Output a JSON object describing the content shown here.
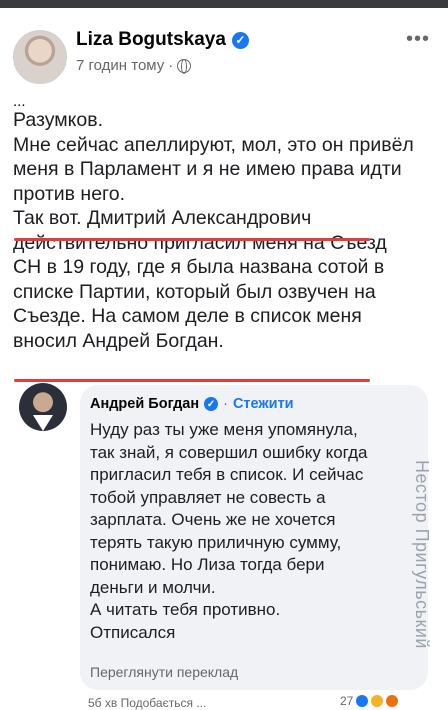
{
  "post": {
    "author": "Liza Bogutskaya",
    "verified_icon": "check",
    "time": "7 годин тому",
    "visibility_icon": "globe-icon",
    "more_label": "•••",
    "ellipsis": "...",
    "lines": [
      "Разумков.",
      "Мне сейчас апеллируют, мол, это он привёл",
      "меня в Парламент и я не имею права идти",
      "против него.",
      "Так вот. Дмитрий Александрович",
      "действительно пригласил меня на Съезд",
      "СН в 19 году, где я была названа сотой в",
      "списке Партии, который был озвучен на",
      "Съезде. На самом деле в список меня",
      "вносил Андрей Богдан."
    ]
  },
  "comment": {
    "author": "Андрей Богдан",
    "separator": "·",
    "follow_label": "Стежити",
    "lines": [
      "Нуду раз ты уже меня упомянула,",
      "так знай, я совершил ошибку когда",
      "пригласил тебя в список. И сейчас",
      "тобой управляет не совесть а",
      "зарплата. Очень же не хочется",
      "терять такую приличную сумму,",
      "понимаю. Но Лиза тогда бери",
      "деньги и молчи.",
      "А читать тебя противно.",
      "Отписался"
    ],
    "translate_label": "Переглянути переклад"
  },
  "watermark": "Нестор Пригульський",
  "footer": {
    "left": "5б хв     Подобається   ...",
    "reactions_count": "27"
  },
  "colors": {
    "underline": "#e63b3b",
    "link": "#1877f2",
    "bubble": "#f0f2f5"
  }
}
